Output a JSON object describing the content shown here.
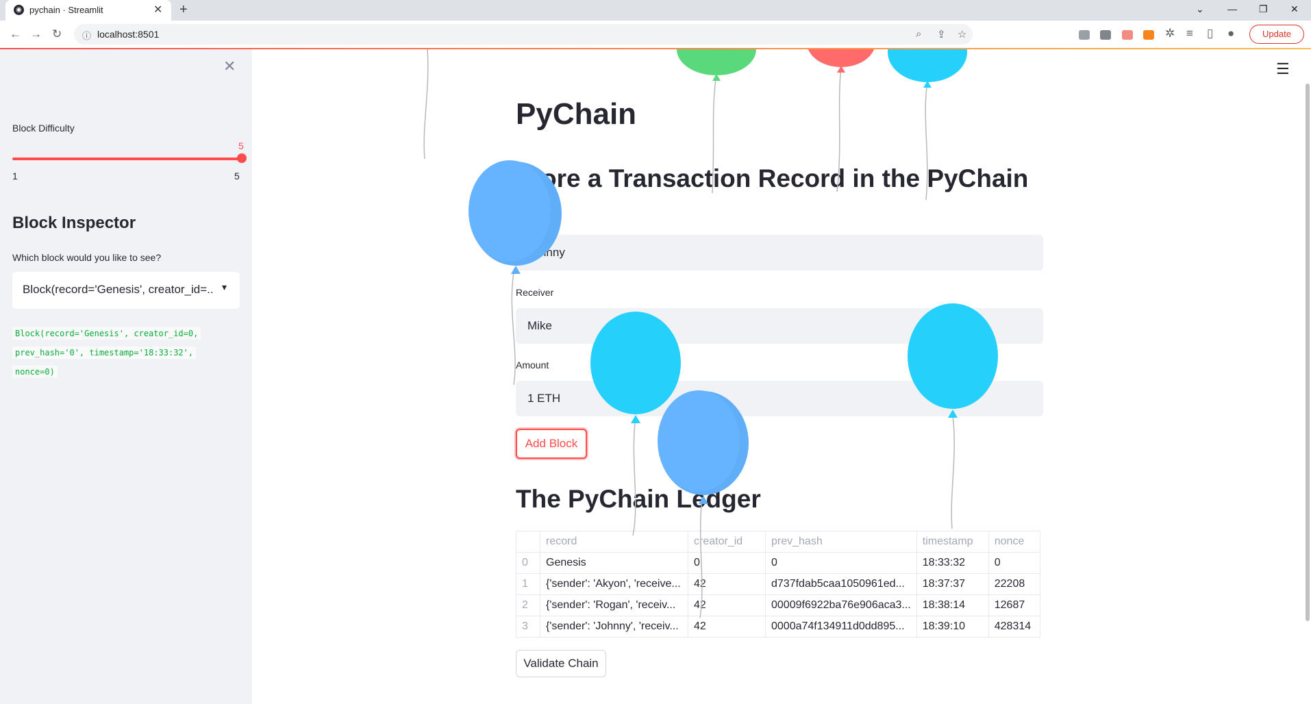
{
  "browser": {
    "tab_title": "pychain · Streamlit",
    "url": "localhost:8501",
    "update_label": "Update"
  },
  "sidebar": {
    "difficulty_label": "Block Difficulty",
    "difficulty_value": "5",
    "difficulty_min": "1",
    "difficulty_max": "5",
    "inspector_heading": "Block Inspector",
    "inspector_prompt": "Which block would you like to see?",
    "selected_block": "Block(record='Genesis', creator_id=...",
    "block_code": [
      "Block(record='Genesis', creator_id=0,",
      "prev_hash='0', timestamp='18:33:32',",
      "nonce=0)"
    ]
  },
  "main": {
    "title": "PyChain",
    "subtitle": "Store a Transaction Record in the PyChain",
    "sender_value": "Johnny",
    "receiver_label": "Receiver",
    "receiver_value": "Mike",
    "amount_label": "Amount",
    "amount_value": "1 ETH",
    "add_block_label": "Add Block",
    "ledger_title": "The PyChain Ledger",
    "validate_label": "Validate Chain"
  },
  "ledger": {
    "columns": [
      "",
      "record",
      "creator_id",
      "prev_hash",
      "timestamp",
      "nonce"
    ],
    "rows": [
      [
        "0",
        "Genesis",
        "0",
        "0",
        "18:33:32",
        "0"
      ],
      [
        "1",
        "{'sender': 'Akyon', 'receive...",
        "42",
        "d737fdab5caa1050961ed...",
        "18:37:37",
        "22208"
      ],
      [
        "2",
        "{'sender': 'Rogan', 'receiv...",
        "42",
        "00009f6922ba76e906aca3...",
        "18:38:14",
        "12687"
      ],
      [
        "3",
        "{'sender': 'Johnny', 'receiv...",
        "42",
        "0000a74f134911d0dd895...",
        "18:39:10",
        "428314"
      ]
    ]
  },
  "colors": {
    "accent": "#ff4b4b",
    "sidebar_bg": "#f0f2f6",
    "code_green": "#09ab3b",
    "balloon_blue": "#60aef8",
    "balloon_cyan": "#25d0fb",
    "balloon_green": "#5ad97c",
    "balloon_red": "#ff6b6b"
  }
}
